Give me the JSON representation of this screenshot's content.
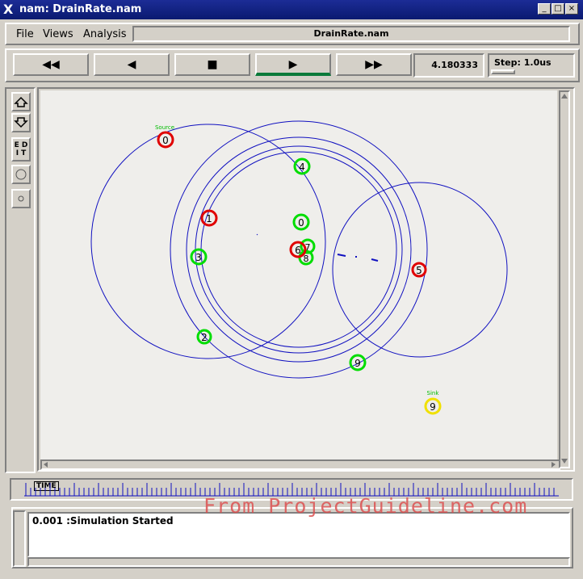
{
  "window": {
    "title": "nam: DrainRate.nam",
    "logo": "X",
    "minimize": "_",
    "maximize": "□",
    "close": "×"
  },
  "menu": {
    "file": "File",
    "views": "Views",
    "analysis": "Analysis",
    "filename": "DrainRate.nam"
  },
  "controls": {
    "fast_rewind": "◀◀",
    "rewind": "◀",
    "stop": "■",
    "play": "▶",
    "fast_forward": "▶▶",
    "time": "4.180333",
    "step": "Step: 1.0us"
  },
  "tools": {
    "edit": "E D I T"
  },
  "timeline": {
    "label": "TIME"
  },
  "log": {
    "message": "0.001 :Simulation Started"
  },
  "watermark": "From ProjectGuideline.com",
  "topology": {
    "labels": {
      "source": "Source",
      "sink": "Sink"
    },
    "nodes": [
      {
        "id": "0",
        "color": "#e00000",
        "label": "0"
      },
      {
        "id": "4",
        "color": "#00dd00",
        "label": "4"
      },
      {
        "id": "0b",
        "color": "#00dd00",
        "label": "0"
      },
      {
        "id": "1",
        "color": "#e00000",
        "label": "1"
      },
      {
        "id": "6",
        "color": "#e00000",
        "label": "6"
      },
      {
        "id": "7",
        "color": "#00dd00",
        "label": "7"
      },
      {
        "id": "8",
        "color": "#00dd00",
        "label": "8"
      },
      {
        "id": "3",
        "color": "#00dd00",
        "label": "3"
      },
      {
        "id": "5",
        "color": "#e00000",
        "label": "5"
      },
      {
        "id": "2",
        "color": "#00dd00",
        "label": "2"
      },
      {
        "id": "9b",
        "color": "#00dd00",
        "label": "9"
      },
      {
        "id": "9",
        "color": "#f0e000",
        "label": "9"
      }
    ],
    "ring_color": "#1010c0"
  }
}
